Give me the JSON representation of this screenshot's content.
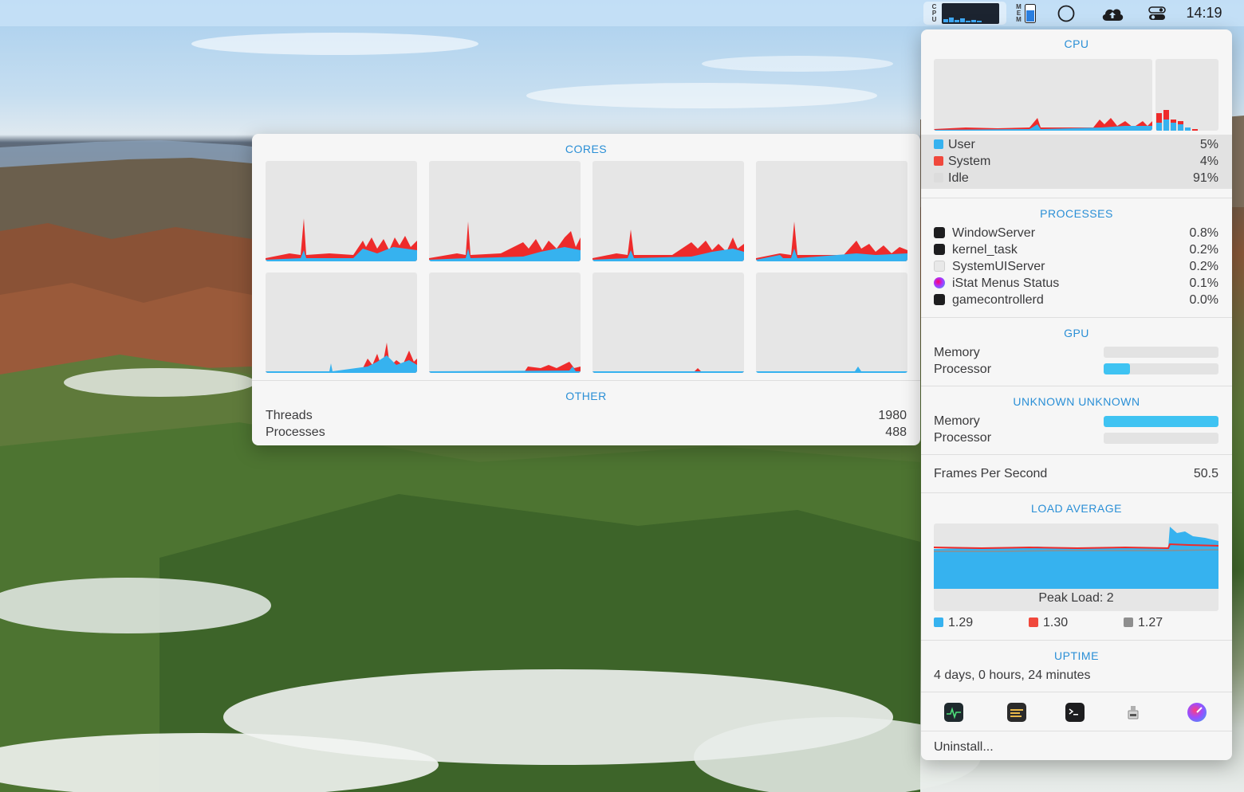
{
  "menubar": {
    "cpu_label": "CPU",
    "mem_label": "MEM",
    "clock": "14:19"
  },
  "cores_window": {
    "title": "CORES",
    "other_title": "OTHER",
    "rows": [
      {
        "label": "Threads",
        "value": "1980"
      },
      {
        "label": "Processes",
        "value": "488"
      }
    ]
  },
  "panel": {
    "cpu": {
      "title": "CPU",
      "rows": [
        {
          "label": "User",
          "value": "5%",
          "color": "#36b2ef"
        },
        {
          "label": "System",
          "value": "4%",
          "color": "#f0483c"
        },
        {
          "label": "Idle",
          "value": "91%",
          "color": "#e2e2e2"
        }
      ]
    },
    "processes": {
      "title": "PROCESSES",
      "items": [
        {
          "name": "WindowServer",
          "value": "0.8%",
          "icon": "terminal-icon"
        },
        {
          "name": "kernel_task",
          "value": "0.2%",
          "icon": "terminal-icon"
        },
        {
          "name": "SystemUIServer",
          "value": "0.2%",
          "icon": "blank-app-icon"
        },
        {
          "name": "iStat Menus Status",
          "value": "0.1%",
          "icon": "istat-icon"
        },
        {
          "name": "gamecontrollerd",
          "value": "0.0%",
          "icon": "terminal-icon"
        }
      ]
    },
    "gpu": {
      "title": "GPU",
      "rows": [
        {
          "label": "Memory",
          "fill": 0.0
        },
        {
          "label": "Processor",
          "fill": 0.23
        }
      ]
    },
    "gpu2": {
      "title": "UNKNOWN UNKNOWN",
      "rows": [
        {
          "label": "Memory",
          "fill": 1.0
        },
        {
          "label": "Processor",
          "fill": 0.0
        }
      ]
    },
    "fps": {
      "label": "Frames Per Second",
      "value": "50.5"
    },
    "load": {
      "title": "LOAD AVERAGE",
      "peak": "Peak Load: 2",
      "legend": [
        {
          "value": "1.29",
          "color": "#36b2ef"
        },
        {
          "value": "1.30",
          "color": "#f0483c"
        },
        {
          "value": "1.27",
          "color": "#8e8e8e"
        }
      ]
    },
    "uptime": {
      "title": "UPTIME",
      "value": "4 days, 0 hours, 24 minutes"
    },
    "dock_icons": [
      "activity-monitor-icon",
      "console-icon",
      "terminal-icon",
      "system-information-icon",
      "istat-icon"
    ],
    "uninstall": "Uninstall..."
  },
  "colors": {
    "accent": "#2a8fd6",
    "user": "#36b2ef",
    "system": "#f0483c"
  }
}
